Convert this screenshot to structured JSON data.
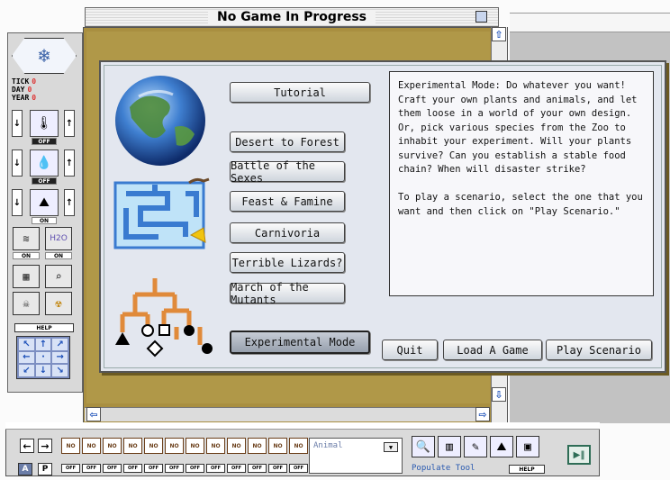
{
  "window": {
    "title": "No Game In Progress"
  },
  "stats": [
    {
      "label": "TICK",
      "value": "0"
    },
    {
      "label": "DAY",
      "value": "0"
    },
    {
      "label": "YEAR",
      "value": "0"
    }
  ],
  "palette": {
    "tags": [
      "OFF",
      "OFF",
      "ON"
    ],
    "toggle_tags": [
      "ON",
      "ON"
    ],
    "h2o_label": "H2O",
    "help_label": "HELP"
  },
  "scenarios": [
    {
      "label": "Tutorial"
    },
    {
      "label": "Desert to Forest"
    },
    {
      "label": "Battle of the Sexes"
    },
    {
      "label": "Feast & Famine"
    },
    {
      "label": "Carnivoria"
    },
    {
      "label": "Terrible Lizards?"
    },
    {
      "label": "March of the Mutants"
    },
    {
      "label": "Experimental Mode",
      "selected": true
    }
  ],
  "description": {
    "text": "Experimental Mode: Do whatever you want!\nCraft your own plants and animals, and let\nthem loose in a world of your own design.\nOr, pick various species from the Zoo to\ninhabit your experiment. Will your plants\nsurvive? Can you establish a stable food\nchain? When will disaster strike?\n\nTo play a scenario, select the one that you\nwant and then click on \"Play Scenario.\""
  },
  "actions": {
    "quit": "Quit",
    "load": "Load A Game",
    "play": "Play Scenario"
  },
  "bottom": {
    "slot_label": "NO",
    "slot_state": "OFF",
    "slots": 12,
    "a_label": "A",
    "p_label": "P",
    "category": "Animal",
    "tool_name": "Populate Tool",
    "help_label": "HELP"
  }
}
